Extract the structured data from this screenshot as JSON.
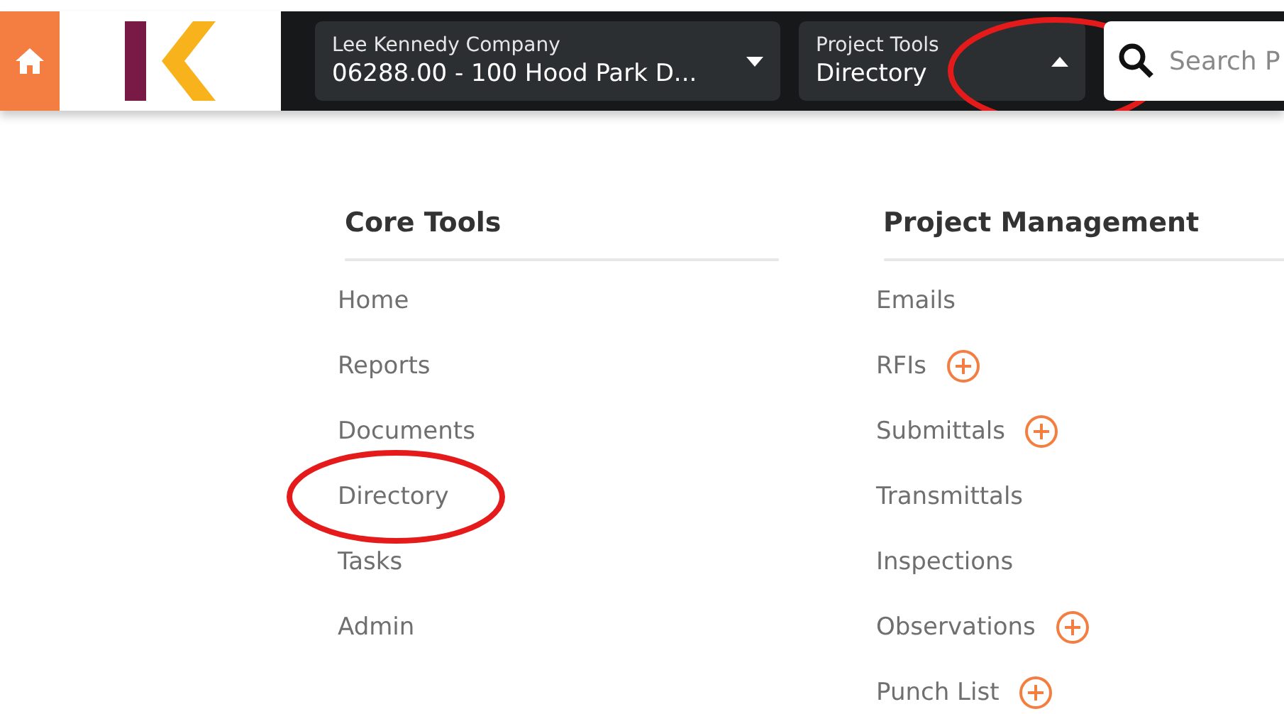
{
  "header": {
    "project_picker": {
      "label": "Lee Kennedy Company",
      "value": "06288.00 - 100 Hood Park D...",
      "expanded": false,
      "circled": false
    },
    "tools_picker": {
      "label": "Project Tools",
      "value": "Directory",
      "expanded": true,
      "circled": true
    },
    "search": {
      "placeholder": "Search P"
    }
  },
  "sections": [
    {
      "title": "Core Tools",
      "items": [
        {
          "label": "Home",
          "addable": false,
          "circled": false
        },
        {
          "label": "Reports",
          "addable": false,
          "circled": false
        },
        {
          "label": "Documents",
          "addable": false,
          "circled": false
        },
        {
          "label": "Directory",
          "addable": false,
          "circled": true
        },
        {
          "label": "Tasks",
          "addable": false,
          "circled": false
        },
        {
          "label": "Admin",
          "addable": false,
          "circled": false
        }
      ]
    },
    {
      "title": "Project Management",
      "items": [
        {
          "label": "Emails",
          "addable": false,
          "circled": false
        },
        {
          "label": "RFIs",
          "addable": true,
          "circled": false
        },
        {
          "label": "Submittals",
          "addable": true,
          "circled": false
        },
        {
          "label": "Transmittals",
          "addable": false,
          "circled": false
        },
        {
          "label": "Inspections",
          "addable": false,
          "circled": false
        },
        {
          "label": "Observations",
          "addable": true,
          "circled": false
        },
        {
          "label": "Punch List",
          "addable": true,
          "circled": false
        }
      ]
    }
  ]
}
